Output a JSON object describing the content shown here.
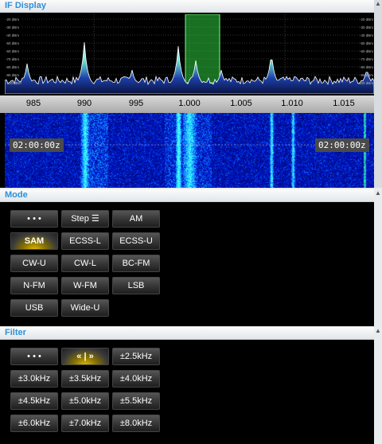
{
  "if_display": {
    "title": "IF Display",
    "db_labels": [
      "-20 dBm",
      "-30 dBm",
      "-40 dBm",
      "-50 dBm",
      "-60 dBm",
      "-70 dBm",
      "-80 dBm",
      "-90 dBm",
      "-100 dBm"
    ],
    "freq_labels": [
      "985",
      "990",
      "995",
      "1.000",
      "1.005",
      "1.010",
      "1.015"
    ],
    "time_left": "02:00:00z",
    "time_right": "02:00:00z",
    "passband_color": "#2ecc40"
  },
  "mode": {
    "title": "Mode",
    "buttons": [
      "• • •",
      "Step ☰",
      "AM",
      "SAM",
      "ECSS-L",
      "ECSS-U",
      "CW-U",
      "CW-L",
      "BC-FM",
      "N-FM",
      "W-FM",
      "LSB",
      "USB",
      "Wide-U"
    ],
    "selected": "SAM"
  },
  "filter": {
    "title": "Filter",
    "buttons": [
      "• • •",
      "« | »",
      "±2.5kHz",
      "±3.0kHz",
      "±3.5kHz",
      "±4.0kHz",
      "±4.5kHz",
      "±5.0kHz",
      "±5.5kHz",
      "±6.0kHz",
      "±7.0kHz",
      "±8.0kHz"
    ],
    "selected": "« | »"
  }
}
